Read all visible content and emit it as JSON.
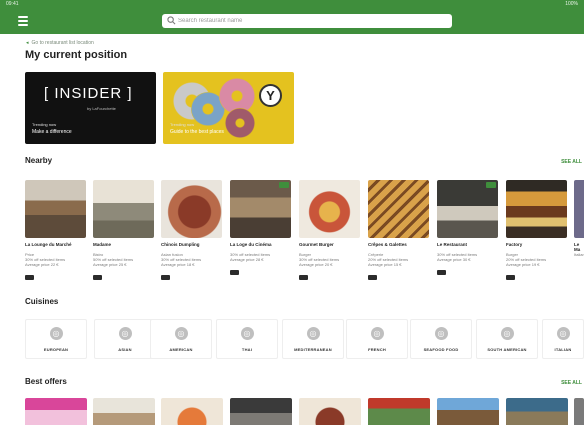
{
  "statusbar": {
    "time": "09:41",
    "system": "100%"
  },
  "search": {
    "placeholder": "Search restaurant name"
  },
  "breadcrumb": {
    "label": "Go to restaurant list location"
  },
  "page_title": "My current position",
  "promos": [
    {
      "logo": "[ INSIDER ]",
      "sub": "by LaFourchette",
      "small": "Trending now",
      "big": "Make a difference"
    },
    {
      "logo": "Y",
      "small": "Trending now",
      "big": "Guide to the best places"
    }
  ],
  "nearby": {
    "title": "Nearby",
    "see_all": "SEE ALL",
    "items": [
      {
        "name": "La Lounge du Marché",
        "meta1": "Price",
        "meta2": "30% off selected items",
        "meta3": "Average price 22 €"
      },
      {
        "name": "Madame",
        "meta1": "Bistro",
        "meta2": "50% off selected items",
        "meta3": "Average price 25 €"
      },
      {
        "name": "Chinois Dumpling",
        "meta1": "Asian fusion",
        "meta2": "30% off selected items",
        "meta3": "Average price 18 €"
      },
      {
        "name": "La Loge du Cinéma",
        "meta1": "30% off selected items",
        "meta2": "Average price 28 €",
        "meta3": ""
      },
      {
        "name": "Gourmet Burger",
        "meta1": "Burger",
        "meta2": "30% off selected items",
        "meta3": "Average price 20 €"
      },
      {
        "name": "Crêpes & Galettes",
        "meta1": "Crêperie",
        "meta2": "20% off selected items",
        "meta3": "Average price 15 €"
      },
      {
        "name": "Le Restaurant",
        "meta1": "30% off selected items",
        "meta2": "Average price 30 €",
        "meta3": ""
      },
      {
        "name": "Factory",
        "meta1": "Burger",
        "meta2": "20% off selected items",
        "meta3": "Average price 19 €"
      },
      {
        "name": "Le Ma",
        "meta1": "Italian",
        "meta2": "",
        "meta3": ""
      }
    ]
  },
  "cuisines": {
    "title": "Cuisines",
    "items": [
      "EUROPEAN",
      "ASIAN",
      "AMERICAN",
      "THAI",
      "MEDITERRANEAN",
      "FRENCH",
      "SEAFOOD FOOD",
      "SOUTH AMERICAN",
      "ITALIAN"
    ]
  },
  "best_offers": {
    "title": "Best offers",
    "see_all": "SEE ALL"
  },
  "colors": {
    "brand": "#3f8e3c",
    "accent_yellow": "#e4c21f"
  }
}
